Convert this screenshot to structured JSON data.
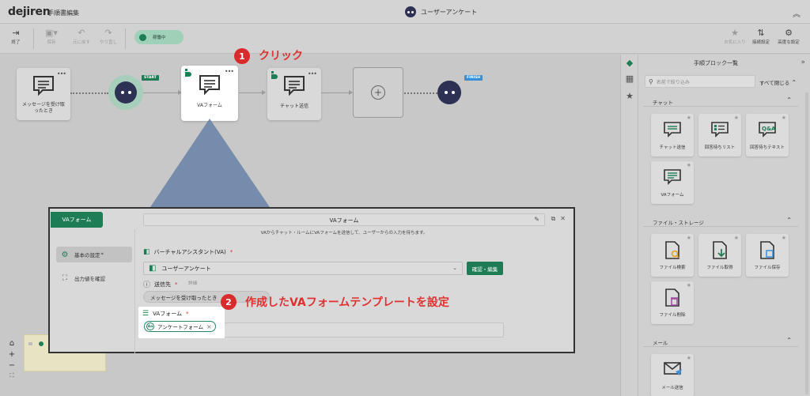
{
  "header": {
    "logo": "dejiren",
    "page_title": "手順書編集",
    "flow_name": "ユーザーアンケート",
    "collapse_icon": "double-chevron-up-icon"
  },
  "toolbar": {
    "exit_label": "終了",
    "save_label": "保存",
    "undo_label": "元に戻す",
    "redo_label": "やり直し",
    "status_label": "稼働中",
    "favorites_label": "お気に入り",
    "connection_label": "接続設定",
    "advanced_label": "高度な設定"
  },
  "flow": {
    "receive_node": "メッセージを受け取ったとき",
    "start_tag": "START",
    "va_node": "VAフォーム",
    "chat_node": "チャット送信",
    "finish_tag": "FINISH",
    "more": "•••"
  },
  "annotations": {
    "step1_number": "1",
    "step1_text": "クリック",
    "step2_number": "2",
    "step2_text": "作成したVAフォームテンプレートを設定"
  },
  "modal": {
    "tab_label": "VAフォーム",
    "title": "VAフォーム",
    "description": "VAからチャット・ルームにVAフォームを送信して、ユーザーからの入力を待ちます。",
    "sidebar": [
      {
        "label": "基本の設定",
        "suffix": "*"
      },
      {
        "label": "出力値を確認"
      }
    ],
    "va_label": "バーチャルアシスタント(VA)",
    "va_value": "ユーザーアンケート",
    "confirm_button": "確認・編集",
    "dest_label": "送信先",
    "dest_detail": "詳細",
    "dest_value": "メッセージを受け取ったとき",
    "form_label": "VAフォーム",
    "form_value": "アンケートフォーム",
    "form_chip_icon": "Aa",
    "required_mark": "*"
  },
  "right_panel": {
    "title": "手順ブロック一覧",
    "search_placeholder": "名前で絞り込み",
    "close_all": "すべて閉じる",
    "sections": [
      {
        "title": "チャット",
        "items": [
          "チャット送信",
          "回答待ちリスト",
          "回答待ちテキスト",
          "VAフォーム"
        ]
      },
      {
        "title": "ファイル・ストレージ",
        "items": [
          "ファイル検索",
          "ファイル取得",
          "ファイル保存",
          "ファイル削除"
        ]
      },
      {
        "title": "メール",
        "items": [
          "メール送信"
        ]
      }
    ]
  },
  "colors": {
    "accent": "#1f7d55",
    "annotation_red": "#e03030",
    "bot": "#2d3254"
  }
}
